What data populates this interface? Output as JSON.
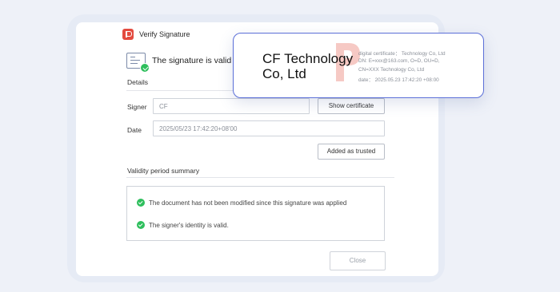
{
  "dialog": {
    "title": "Verify Signature",
    "status": "The signature is valid",
    "details_label": "Details",
    "signer_label": "Signer",
    "signer_value": "CF",
    "show_certificate": "Show certificate",
    "date_label": "Date",
    "date_value": "2025/05/23 17:42:20+08'00",
    "added_trusted": "Added as trusted",
    "validity_label": "Validity period summary",
    "validity_items": [
      "The document has not been modified since this signature was applied",
      "The signer's identity is valid."
    ],
    "close": "Close"
  },
  "popover": {
    "company_line1": "CF Technology",
    "company_line2": "Co, Ltd",
    "details": [
      "digital certificate： Technology Co, Ltd",
      "DN: E=xxx@163.com, O=D, OU=D,",
      "CN=XXX Technology Co, Ltd",
      "date： 2025.05.23  17:42:20 +08:00"
    ]
  },
  "colors": {
    "accent": "#5b6fd8",
    "brand": "#e34b3f",
    "success": "#2fbf5d",
    "watermark": "#f6c9c4"
  }
}
